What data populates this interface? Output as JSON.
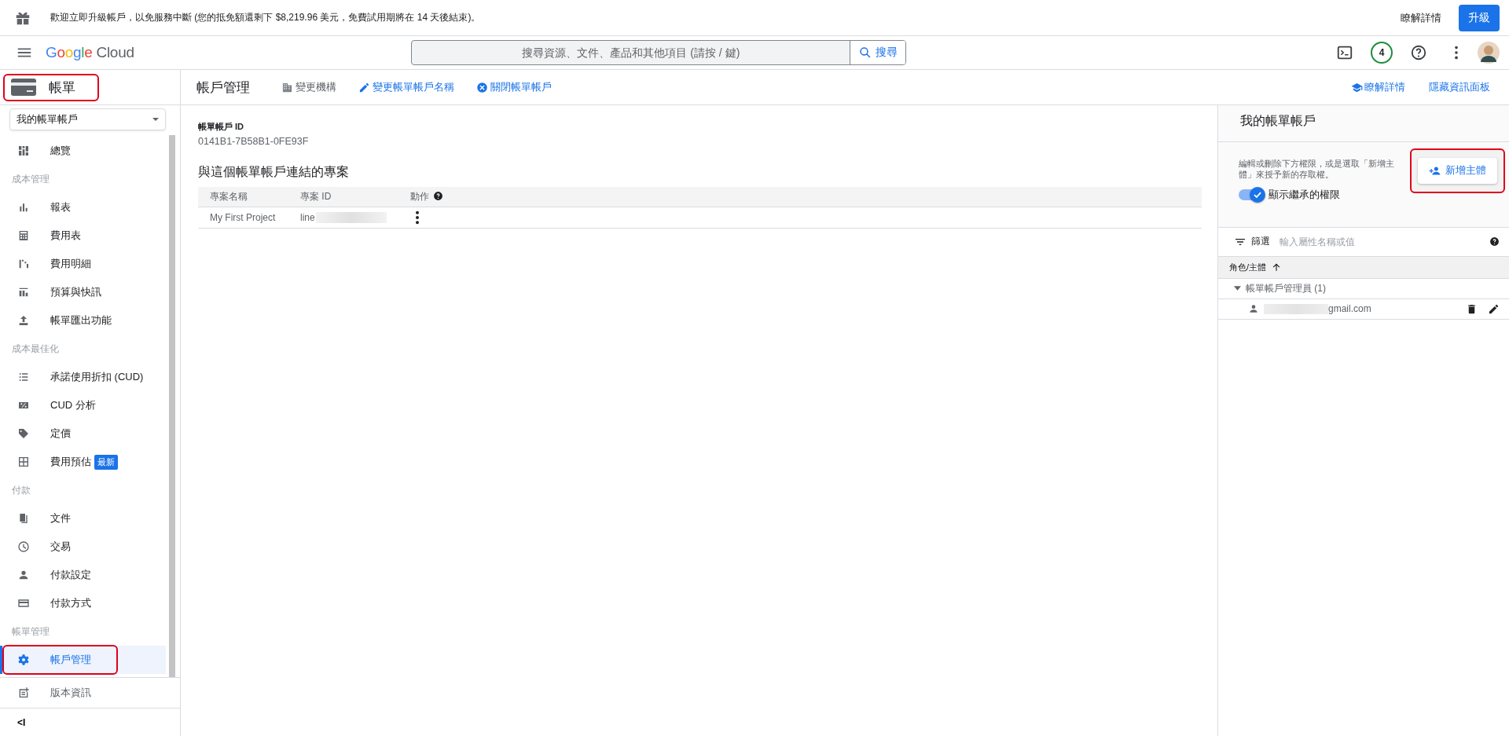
{
  "banner": {
    "message": "歡迎立即升級帳戶，以免服務中斷 (您的抵免額還剩下 $8,219.96 美元，免費試用期將在 14 天後結束)。",
    "link": "瞭解詳情",
    "button": "升級"
  },
  "header": {
    "logo": "Google Cloud",
    "search": {
      "placeholder": "搜尋資源、文件、產品和其他項目 (請按 / 鍵)",
      "button": "搜尋"
    },
    "notifications": "4"
  },
  "sidebar": {
    "title": "帳單",
    "account_select": "我的帳單帳戶",
    "sections": [
      {
        "items": [
          {
            "label": "總覽",
            "selected": false
          }
        ]
      },
      {
        "heading": "成本管理",
        "items": [
          {
            "label": "報表",
            "selected": false
          },
          {
            "label": "費用表",
            "selected": false
          },
          {
            "label": "費用明細",
            "selected": false
          },
          {
            "label": "預算與快訊",
            "selected": false
          },
          {
            "label": "帳單匯出功能",
            "selected": false
          }
        ]
      },
      {
        "heading": "成本最佳化",
        "items": [
          {
            "label": "承諾使用折扣 (CUD)",
            "selected": false
          },
          {
            "label": "CUD 分析",
            "selected": false
          },
          {
            "label": "定價",
            "selected": false
          },
          {
            "label": "費用預估",
            "badge": "最新",
            "selected": false
          }
        ]
      },
      {
        "heading": "付款",
        "items": [
          {
            "label": "文件",
            "selected": false
          },
          {
            "label": "交易",
            "selected": false
          },
          {
            "label": "付款設定",
            "selected": false
          },
          {
            "label": "付款方式",
            "selected": false
          }
        ]
      },
      {
        "heading": "帳單管理",
        "items": [
          {
            "label": "帳戶管理",
            "selected": true
          }
        ]
      }
    ],
    "footer_item": "版本資訊",
    "collapse": "<I"
  },
  "toolbar": {
    "title": "帳戶管理",
    "actions": [
      {
        "label": "變更機構",
        "disabled": true
      },
      {
        "label": "變更帳單帳戶名稱",
        "disabled": false
      },
      {
        "label": "關閉帳單帳戶",
        "disabled": false
      }
    ],
    "links": [
      "瞭解詳情",
      "隱藏資訊面板"
    ]
  },
  "account": {
    "label": "帳單帳戶 ID",
    "id": "0141B1-7B58B1-0FE93F"
  },
  "projects": {
    "heading": "與這個帳單帳戶連結的專案",
    "columns": [
      "專案名稱",
      "專案 ID",
      "動作"
    ],
    "rows": [
      {
        "name": "My First Project",
        "id": "line"
      }
    ]
  },
  "info_panel": {
    "title": "我的帳單帳戶",
    "description": "編輯或刪除下方權限，或是選取「新增主體」來授予新的存取權。",
    "add_button": "新增主體",
    "toggle": {
      "label": "顯示繼承的權限",
      "on": true
    },
    "filter": {
      "label": "篩選",
      "placeholder": "輸入屬性名稱或值"
    },
    "column": "角色/主體",
    "groups": [
      {
        "name": "帳單帳戶管理員 (1)",
        "expanded": true,
        "members": [
          "gmail.com"
        ]
      }
    ]
  }
}
